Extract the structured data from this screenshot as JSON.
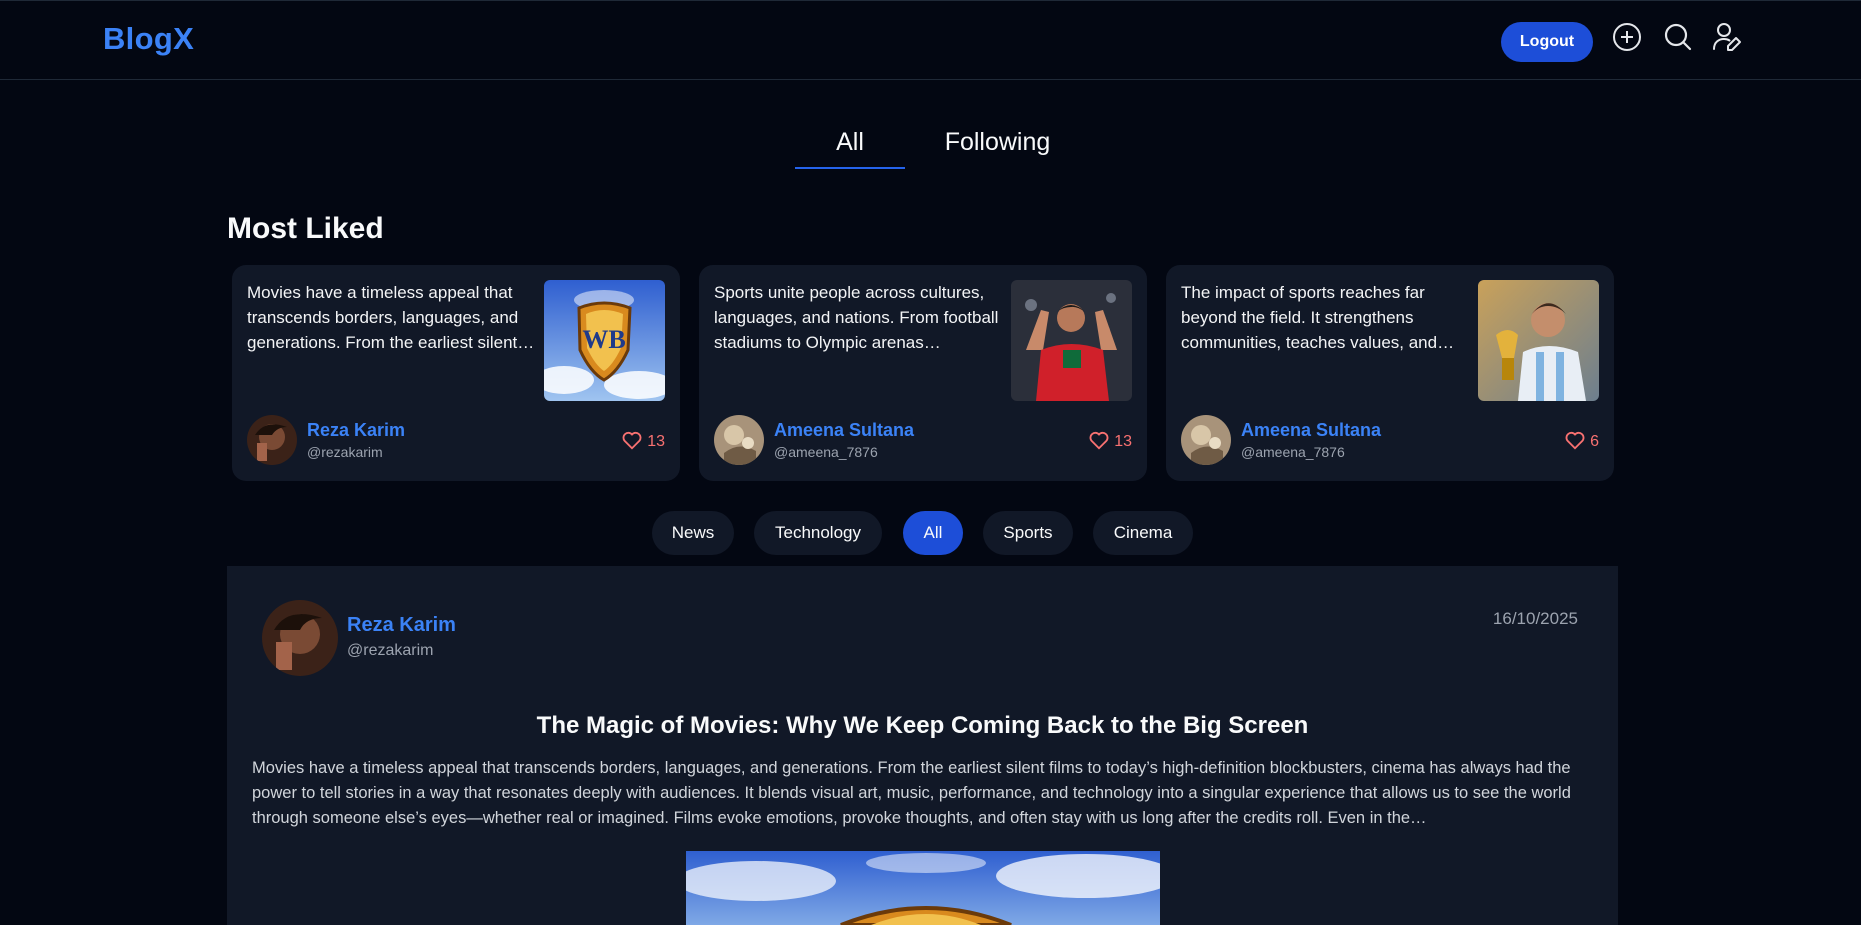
{
  "app": {
    "brand": "BlogX"
  },
  "navbar": {
    "logout_label": "Logout",
    "icons": [
      "add-post-icon",
      "search-icon",
      "profile-edit-icon"
    ]
  },
  "feed_tabs": [
    {
      "label": "All",
      "active": true
    },
    {
      "label": "Following",
      "active": false
    }
  ],
  "most_liked": {
    "title": "Most Liked",
    "cards": [
      {
        "excerpt": "Movies have a timeless appeal that transcends borders, languages, and generations. From the earliest silent…",
        "thumb": "warner-bros-shield",
        "author": "Reza Karim",
        "handle": "@rezakarim",
        "likes": "13"
      },
      {
        "excerpt": "Sports unite people across cultures, languages, and nations. From football stadiums to Olympic arenas…",
        "thumb": "footballer-red-jersey",
        "author": "Ameena Sultana",
        "handle": "@ameena_7876",
        "likes": "13"
      },
      {
        "excerpt": "The impact of sports reaches far beyond the field. It strengthens communities, teaches values, and…",
        "thumb": "footballer-with-trophy",
        "author": "Ameena Sultana",
        "handle": "@ameena_7876",
        "likes": "6"
      }
    ]
  },
  "categories": [
    {
      "label": "News",
      "active": false
    },
    {
      "label": "Technology",
      "active": false
    },
    {
      "label": "All",
      "active": true
    },
    {
      "label": "Sports",
      "active": false
    },
    {
      "label": "Cinema",
      "active": false
    }
  ],
  "post": {
    "author": "Reza Karim",
    "handle": "@rezakarim",
    "date": "16/10/2025",
    "title": "The Magic of Movies: Why We Keep Coming Back to the Big Screen",
    "body": "Movies have a timeless appeal that transcends borders, languages, and generations. From the earliest silent films to today’s high-definition blockbusters, cinema has always had the power to tell stories in a way that resonates deeply with audiences. It blends visual art, music, performance, and technology into a singular experience that allows us to see the world through someone else’s eyes—whether real or imagined. Films evoke emotions, provoke thoughts, and often stay with us long after the credits roll. Even in the…"
  },
  "colors": {
    "background": "#030712",
    "surface": "#111827",
    "accent": "#1d4ed8",
    "link": "#3b82f6",
    "like": "#f87171"
  }
}
